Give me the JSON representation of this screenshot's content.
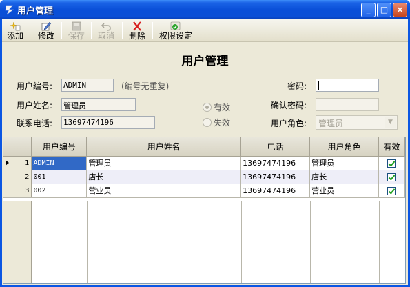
{
  "window": {
    "title": "用户管理",
    "controls": {
      "minimize": "_",
      "maximize": "□",
      "close": "×"
    }
  },
  "toolbar": {
    "items": [
      {
        "label": "添加",
        "icon": "add-sparkle-icon",
        "enabled": true
      },
      {
        "label": "修改",
        "icon": "edit-pencil-icon",
        "enabled": true
      },
      {
        "label": "保存",
        "icon": "save-disk-icon",
        "enabled": false
      },
      {
        "label": "取消",
        "icon": "undo-icon",
        "enabled": false
      },
      {
        "label": "删除",
        "icon": "delete-x-icon",
        "enabled": true
      },
      {
        "label": "权限设定",
        "icon": "permission-check-icon",
        "enabled": true
      }
    ]
  },
  "form": {
    "title": "用户管理",
    "user_id_label": "用户编号:",
    "user_id_value": "ADMIN",
    "user_id_hint": "(编号无重复)",
    "user_name_label": "用户姓名:",
    "user_name_value": "管理员",
    "phone_label": "联系电话:",
    "phone_value": "13697474196",
    "password_label": "密码:",
    "password_value": "",
    "confirm_password_label": "确认密码:",
    "confirm_password_value": "",
    "role_label": "用户角色:",
    "role_value": "管理员",
    "status_valid_label": "有效",
    "status_invalid_label": "失效",
    "status_selected": "有效"
  },
  "grid": {
    "columns": [
      "用户编号",
      "用户姓名",
      "电话",
      "用户角色",
      "有效"
    ],
    "rows": [
      {
        "num": "1",
        "id": "ADMIN",
        "name": "管理员",
        "phone": "13697474196",
        "role": "管理员",
        "valid": true
      },
      {
        "num": "2",
        "id": "001",
        "name": "店长",
        "phone": "13697474196",
        "role": "店长",
        "valid": true
      },
      {
        "num": "3",
        "id": "002",
        "name": "营业员",
        "phone": "13697474196",
        "role": "营业员",
        "valid": true
      }
    ],
    "selected_row": 1
  },
  "colors": {
    "titlebar": "#0a4fd8",
    "window_bg": "#ece9d8",
    "selection": "#3169c6",
    "alt_row": "#eeeef8"
  }
}
